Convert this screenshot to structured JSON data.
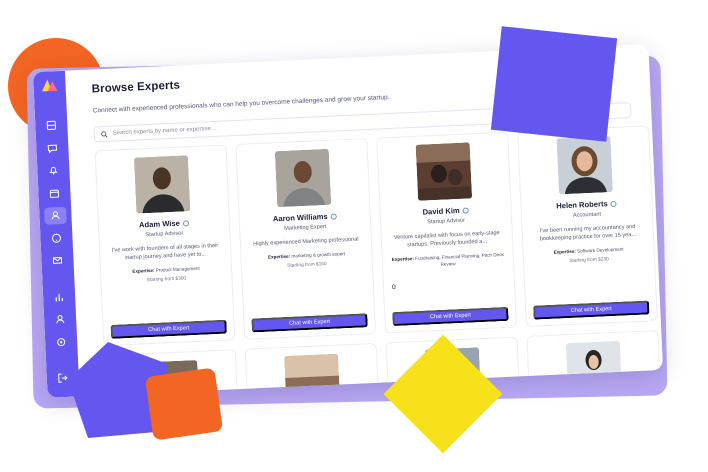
{
  "page": {
    "title": "Browse Experts",
    "subtitle": "Connect with experienced professionals who can help you overcome challenges and grow your startup."
  },
  "search": {
    "placeholder": "Search experts by name or expertise...",
    "value": ""
  },
  "sidebar": {
    "icons": [
      "dashboard-icon",
      "chat-icon",
      "bell-icon",
      "calendar-icon",
      "user-icon",
      "help-icon",
      "mail-icon",
      "chart-icon",
      "profile-icon",
      "settings-icon",
      "logout-icon"
    ],
    "active": "user-icon"
  },
  "experts": [
    {
      "name": "Adam Wise",
      "role": "Startup Advisor",
      "bio": "I've work with founders of all stages in their startup journey and have yet to...",
      "expertise_label": "Expertise:",
      "expertise": "Product Management",
      "price": "Starting from $300",
      "button": "Chat with Expert"
    },
    {
      "name": "Aaron Williams",
      "role": "Marketing Expert",
      "bio": "Highly experienced Marketing professional",
      "expertise_label": "Expertise:",
      "expertise": "marketing & growth expert",
      "price": "Starting from $150",
      "button": "Chat with Expert"
    },
    {
      "name": "David Kim",
      "role": "Startup Advisor",
      "bio": "Venture capitalist with focus on early-stage startups. Previously founded a...",
      "expertise_label": "Expertise:",
      "expertise": "Fundraising, Financial Planning, Pitch Deck Review",
      "price": "",
      "extra": "0",
      "button": "Chat with Expert"
    },
    {
      "name": "Helen Roberts",
      "role": "Accountant",
      "bio": "I've been running my accountancy and bookkeeping practice for over 15 yea...",
      "expertise_label": "Expertise:",
      "expertise": "Software Development",
      "price": "Starting from $230",
      "button": "Chat with Expert"
    }
  ],
  "colors": {
    "accent": "#6457f0",
    "orange": "#f26522",
    "yellow": "#f7e11b",
    "lavender": "#b9a8f4"
  }
}
